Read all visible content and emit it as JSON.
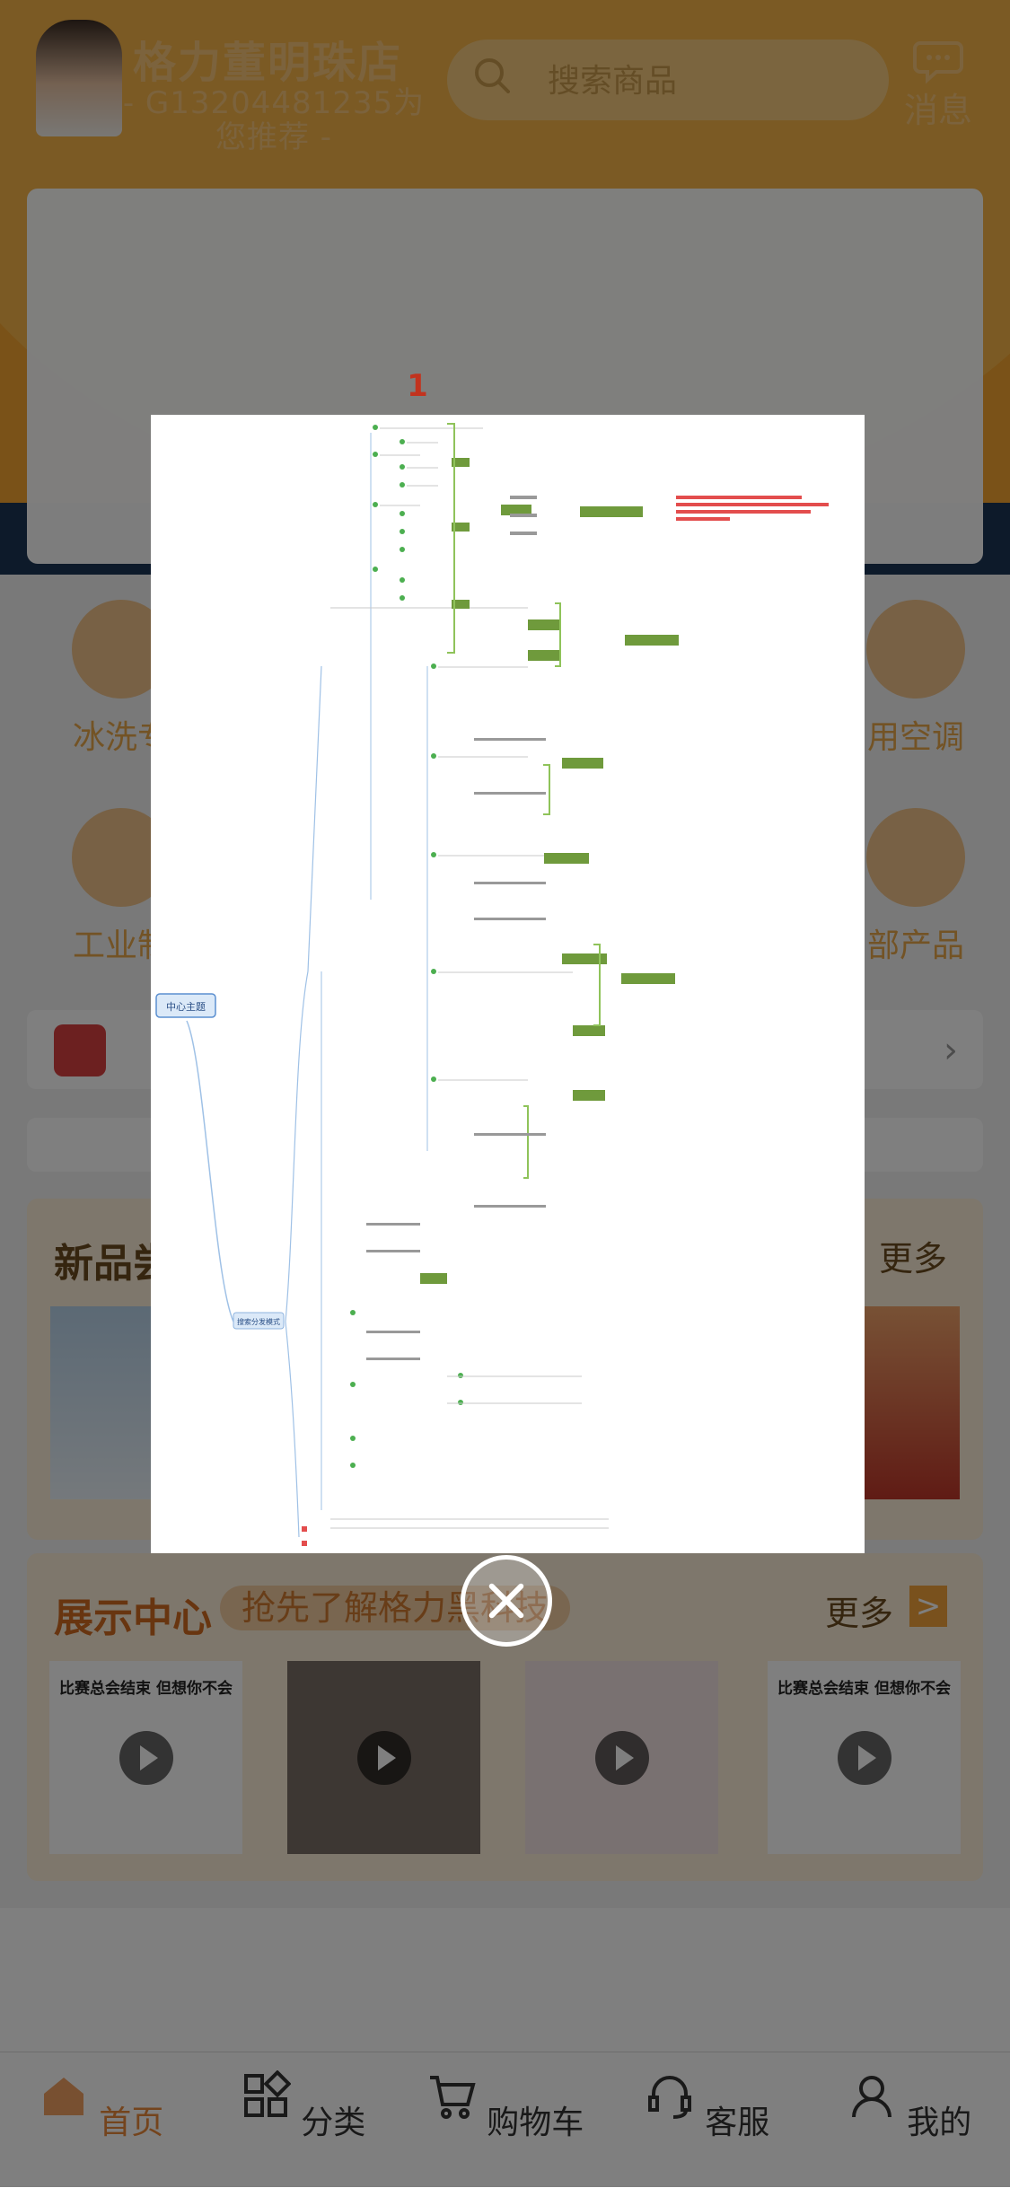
{
  "header": {
    "store_name": "格力董明珠店",
    "recommend_text": "- G13204481235为您推荐 -",
    "search_placeholder": "搜索商品",
    "message_label": "消息"
  },
  "categories": [
    {
      "label": "冰洗专"
    },
    {
      "label": "用空调"
    },
    {
      "label": "工业制"
    },
    {
      "label": "部产品"
    }
  ],
  "new_products": {
    "title": "新品尝",
    "more_label": "更多"
  },
  "showcase": {
    "title": "展示中心",
    "subtitle": "抢先了解格力黑科技",
    "more_label": "更多",
    "videos": [
      {
        "caption": "比赛总会结束  但想你不会"
      },
      {
        "caption": ""
      },
      {
        "caption": ""
      },
      {
        "caption": "比赛总会结束  但想你不会"
      }
    ]
  },
  "tabbar": [
    {
      "label": "首页",
      "icon": "home-icon",
      "active": true
    },
    {
      "label": "分类",
      "icon": "grid-icon",
      "active": false
    },
    {
      "label": "购物车",
      "icon": "cart-icon",
      "active": false
    },
    {
      "label": "客服",
      "icon": "headset-icon",
      "active": false
    },
    {
      "label": "我的",
      "icon": "user-icon",
      "active": false
    }
  ],
  "image_viewer": {
    "page_number": "1",
    "mindmap_root": "中心主题",
    "mindmap_branch": "搜索分发模式",
    "accent_color": "#6f9a3c"
  }
}
